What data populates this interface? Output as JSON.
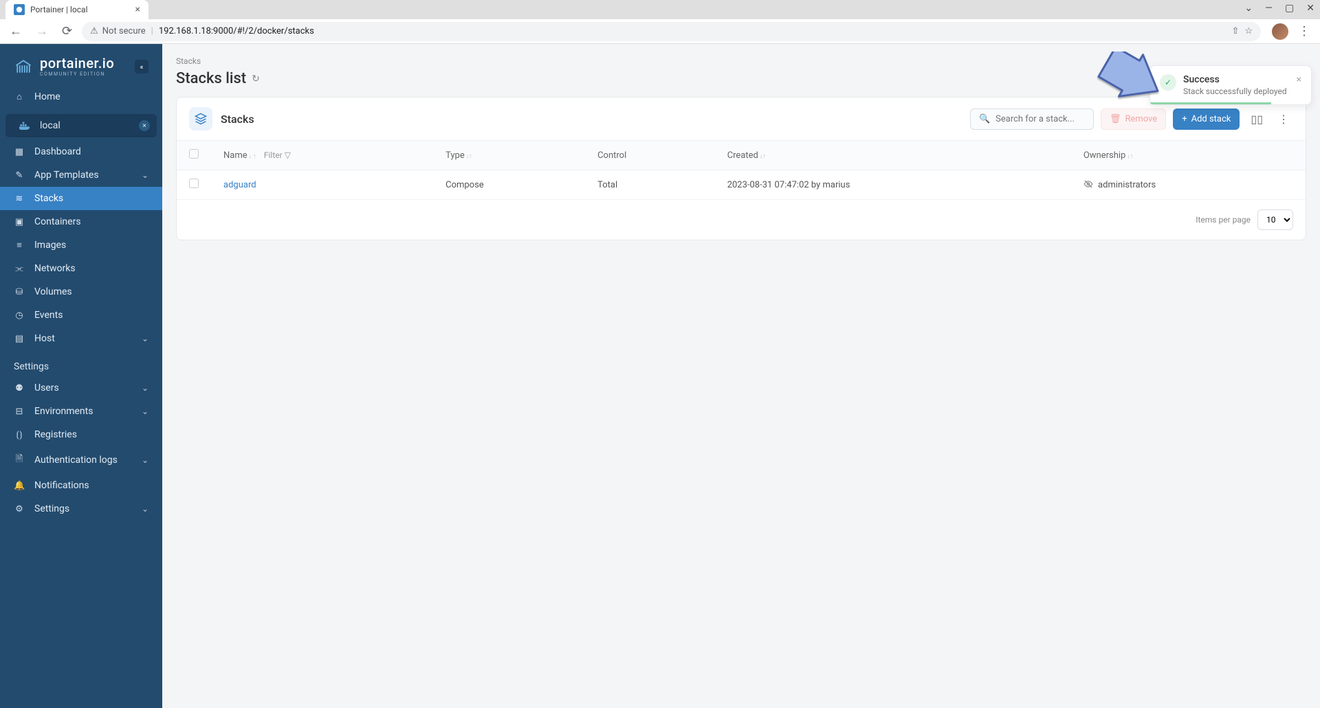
{
  "browser": {
    "tab_title": "Portainer | local",
    "security_label": "Not secure",
    "url": "192.168.1.18:9000/#!/2/docker/stacks"
  },
  "sidebar": {
    "brand": "portainer.io",
    "edition": "COMMUNITY EDITION",
    "home": "Home",
    "env_name": "local",
    "nav": {
      "dashboard": "Dashboard",
      "app_templates": "App Templates",
      "stacks": "Stacks",
      "containers": "Containers",
      "images": "Images",
      "networks": "Networks",
      "volumes": "Volumes",
      "events": "Events",
      "host": "Host"
    },
    "settings_heading": "Settings",
    "settings": {
      "users": "Users",
      "environments": "Environments",
      "registries": "Registries",
      "auth_logs": "Authentication logs",
      "notifications": "Notifications",
      "settings": "Settings"
    }
  },
  "main": {
    "breadcrumb": "Stacks",
    "title": "Stacks list",
    "card_title": "Stacks",
    "search_placeholder": "Search for a stack...",
    "remove_btn": "Remove",
    "add_btn": "Add stack",
    "columns": {
      "name": "Name",
      "filter": "Filter",
      "type": "Type",
      "control": "Control",
      "created": "Created",
      "ownership": "Ownership"
    },
    "rows": [
      {
        "name": "adguard",
        "type": "Compose",
        "control": "Total",
        "created": "2023-08-31 07:47:02 by marius",
        "ownership": "administrators"
      }
    ],
    "items_per_page_label": "Items per page",
    "items_per_page_value": "10"
  },
  "toast": {
    "title": "Success",
    "message": "Stack successfully deployed"
  }
}
